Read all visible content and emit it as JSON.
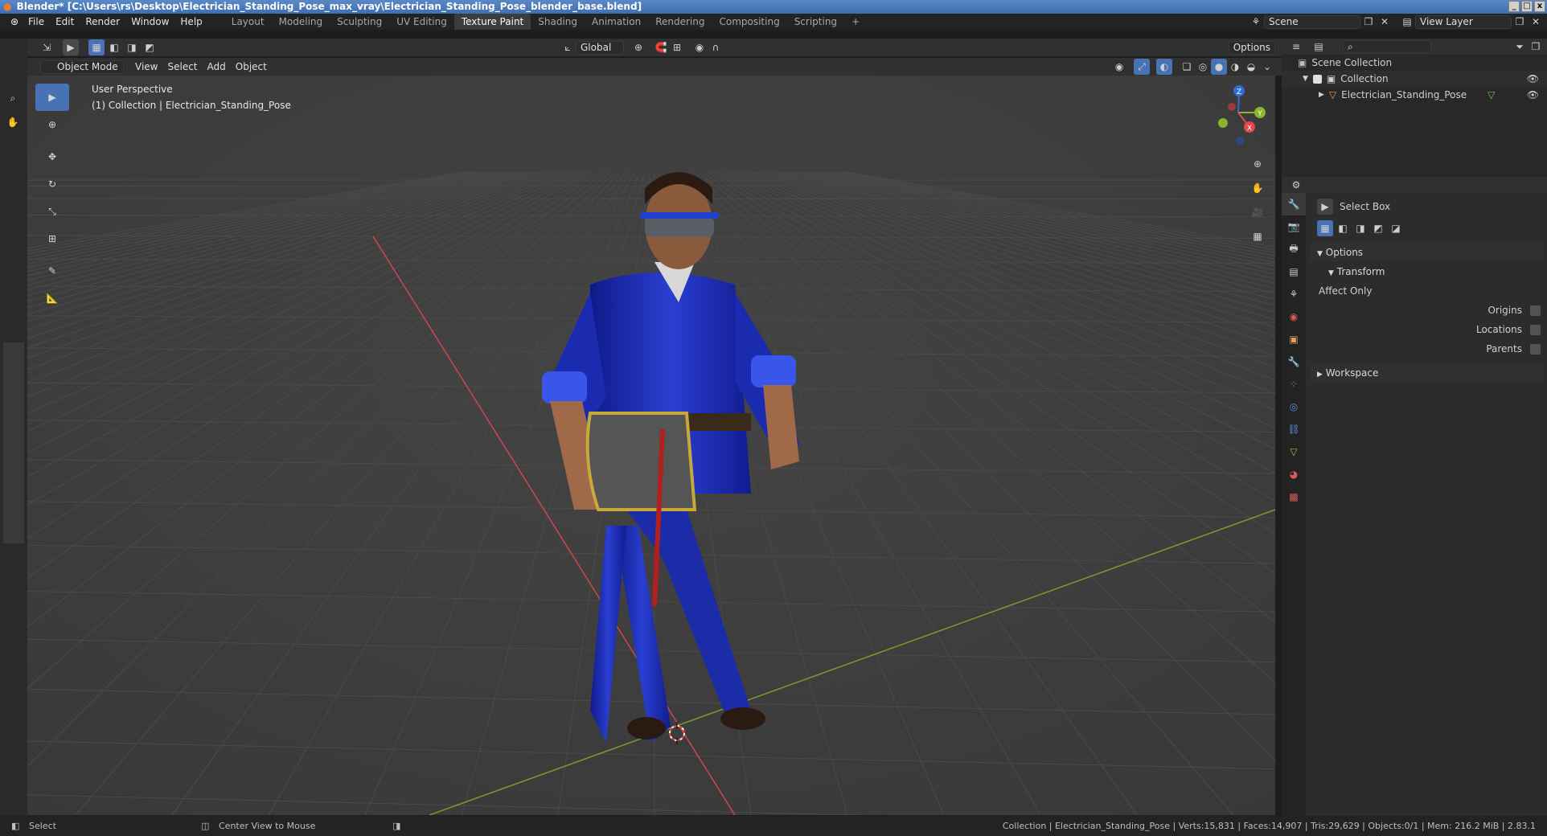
{
  "window": {
    "title": "Blender* [C:\\Users\\rs\\Desktop\\Electrician_Standing_Pose_max_vray\\Electrician_Standing_Pose_blender_base.blend]",
    "controls": [
      "_",
      "□",
      "x"
    ]
  },
  "menubar": {
    "menus": [
      "File",
      "Edit",
      "Render",
      "Window",
      "Help"
    ],
    "workspaces": [
      "Layout",
      "Modeling",
      "Sculpting",
      "UV Editing",
      "Texture Paint",
      "Shading",
      "Animation",
      "Rendering",
      "Compositing",
      "Scripting"
    ],
    "active_workspace": "Texture Paint",
    "add_tab": "+",
    "scene_label": "Scene",
    "view_layer_label": "View Layer"
  },
  "viewport_header": {
    "mode": "Object Mode",
    "menus": [
      "View",
      "Select",
      "Add",
      "Object"
    ],
    "transform_orientation": "Global",
    "options_label": "Options"
  },
  "viewport": {
    "perspective_label": "User Perspective",
    "collection_label": "(1) Collection | Electrician_Standing_Pose",
    "gizmo_axes": {
      "x": "X",
      "y": "Y",
      "z": "Z"
    },
    "colors": {
      "background": "#3d3d3d",
      "x_axis": "#c8484f",
      "y_axis": "#7a9a30",
      "grid": "#474747",
      "accent": "#4772b3",
      "suit": "#1f2fb0"
    }
  },
  "toolbar": {
    "tools": [
      "select-box-tool",
      "cursor-tool",
      "move-tool",
      "rotate-tool",
      "scale-tool",
      "transform-tool",
      "annotate-tool",
      "measure-tool"
    ]
  },
  "outliner": {
    "search_placeholder": "",
    "root": "Scene Collection",
    "items": [
      {
        "name": "Collection",
        "level": 1
      },
      {
        "name": "Electrician_Standing_Pose",
        "level": 2
      }
    ]
  },
  "properties": {
    "tool_name": "Select Box",
    "options_header": "Options",
    "transform_header": "Transform",
    "affect_only_label": "Affect Only",
    "checkboxes": [
      {
        "label": "Origins",
        "checked": false
      },
      {
        "label": "Locations",
        "checked": false
      },
      {
        "label": "Parents",
        "checked": false
      }
    ],
    "workspace_header": "Workspace"
  },
  "statusbar": {
    "left_action": "Select",
    "middle_action": "Center View to Mouse",
    "stats": "Collection | Electrician_Standing_Pose | Verts:15,831 | Faces:14,907 | Tris:29,629 | Objects:0/1 | Mem: 216.2 MiB | 2.83.1"
  }
}
